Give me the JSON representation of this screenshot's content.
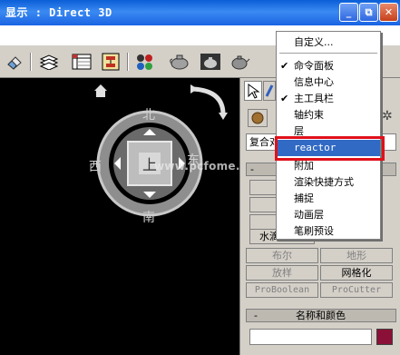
{
  "window": {
    "title": "显示 : Direct 3D",
    "minimize": "_",
    "restore": "⧉",
    "close": "✕"
  },
  "toolbar": {
    "icons": [
      "eraser-icon",
      "layers-icon",
      "spreadsheet-icon",
      "schematic-icon",
      "material-editor-icon",
      "render-scene-icon",
      "quick-render-icon",
      "render-teapot-icon"
    ]
  },
  "viewcube": {
    "north": "北",
    "south": "南",
    "west": "西",
    "east": "东",
    "center": "上"
  },
  "watermark": "www.pcfome.NET",
  "panel": {
    "dropdown_value": "复合对",
    "rollout1_label": "-",
    "partial_texts": [
      "变",
      "水滴"
    ],
    "buttons": [
      {
        "label": "布尔",
        "enabled": false
      },
      {
        "label": "地形",
        "enabled": false
      },
      {
        "label": "放样",
        "enabled": false
      },
      {
        "label": "网格化",
        "enabled": true
      },
      {
        "label": "ProBoolean",
        "enabled": false
      },
      {
        "label": "ProCutter",
        "enabled": false
      }
    ],
    "rollout2_toggle": "-",
    "rollout2_label": "名称和颜色",
    "color_swatch": "#8b1037"
  },
  "menu": {
    "items": [
      {
        "label": "自定义...",
        "checked": false
      },
      {
        "label": "命令面板",
        "checked": true
      },
      {
        "label": "信息中心",
        "checked": false
      },
      {
        "label": "主工具栏",
        "checked": true
      },
      {
        "label": "轴约束",
        "checked": false
      },
      {
        "label": "层",
        "checked": false
      },
      {
        "label": "reactor",
        "checked": false,
        "selected": true
      },
      {
        "label": "附加",
        "checked": false
      },
      {
        "label": "渲染快捷方式",
        "checked": false
      },
      {
        "label": "捕捉",
        "checked": false
      },
      {
        "label": "动画层",
        "checked": false
      },
      {
        "label": "笔刷预设",
        "checked": false
      }
    ],
    "check_mark": "✔"
  },
  "colors": {
    "highlight_box": "#e0101a",
    "menu_selection": "#316ac5",
    "titlebar": "#0a5ed7"
  }
}
